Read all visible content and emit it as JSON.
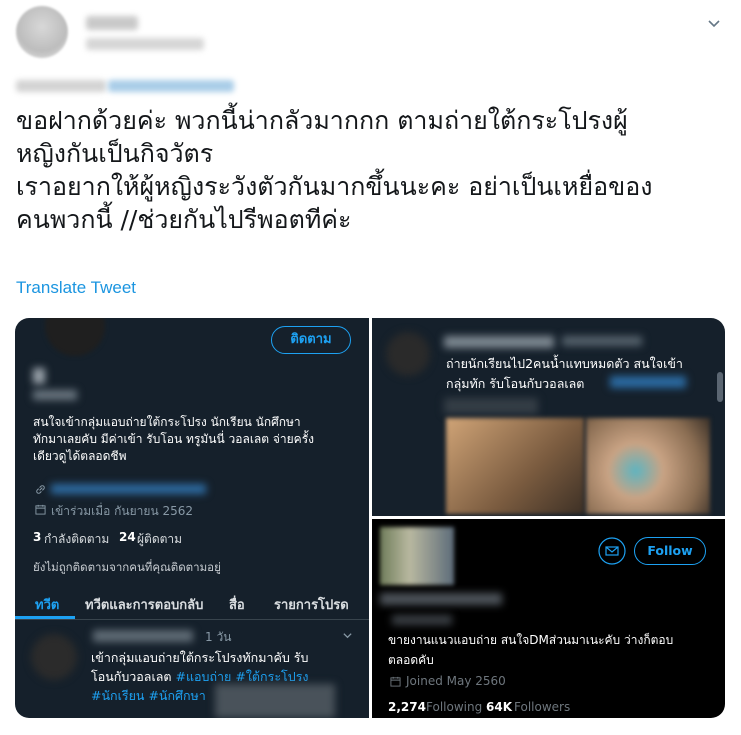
{
  "tweet": {
    "text": "ขอฝากด้วยค่ะ พวกนี้น่ากลัวมากกก ตามถ่ายใต้กระโปรงผู้\nหญิงกันเป็นกิจวัตร\nเราอยากให้ผู้หญิงระวังตัวกันมากขึ้นนะคะ อย่าเป็นเหยื่อของ\nคนพวกนี้ //ช่วยกันไปรีพอตทีค่ะ",
    "translate_label": "Translate Tweet"
  },
  "left_panel": {
    "follow_label": "ติดตาม",
    "bio": "สนใจเข้ากลุ่มแอบถ่ายใต้กระโปรง นักเรียน นักศึกษา\nทักมาเลยคับ มีค่าเข้า รับโอน ทรูมันนี่ วอลเลต จ่ายครั้ง\nเดียวดูได้ตลอดชีพ",
    "joined": "เข้าร่วมเมื่อ กันยายน 2562",
    "following_count": "3",
    "following_label": "กำลังติดตาม",
    "followers_count": "24",
    "followers_label": "ผู้ติดตาม",
    "not_followed_note": "ยังไม่ถูกติดตามจากคนที่คุณติดตามอยู่",
    "tabs": [
      "ทวีต",
      "ทวีตและการตอบกลับ",
      "สื่อ",
      "รายการโปรด"
    ],
    "tweet_time": "1 วัน",
    "tweet_line1": "เข้ากลุ่มแอบถ่ายใต้กระโปรงทักมาคับ รับ",
    "tweet_line2_prefix": "โอนกับวอลเลต ",
    "tag1": "#แอบถ่าย",
    "tag2": "#ใต้กระโปรง",
    "tag3": "#นักเรียน",
    "tag4": "#นักศึกษา"
  },
  "top_right_panel": {
    "text_line1": "ถ่ายนักเรียนไป2คนน้ำแทบหมดตัว สนใจเข้า",
    "text_line2": "กลุ่มทัก รับโอนกับวอลเลต"
  },
  "bottom_right_panel": {
    "follow_label": "Follow",
    "bio_line1": "ขายงานแนวแอบถ่าย สนใจDMส่วนมาเนะคับ ว่างก็ตอบ",
    "bio_line2": "ตลอดคับ",
    "joined": "Joined May 2560",
    "following_count": "2,274",
    "following_label": "Following",
    "followers_count": "64K",
    "followers_label": "Followers"
  },
  "icons": {
    "chevron": "chevron-down-icon",
    "link": "link-icon",
    "calendar": "calendar-icon",
    "message": "message-icon"
  },
  "colors": {
    "accent": "#1da1f2",
    "dark_bg": "#15202b",
    "muted": "#8899a6",
    "translate": "#1b95e0"
  }
}
